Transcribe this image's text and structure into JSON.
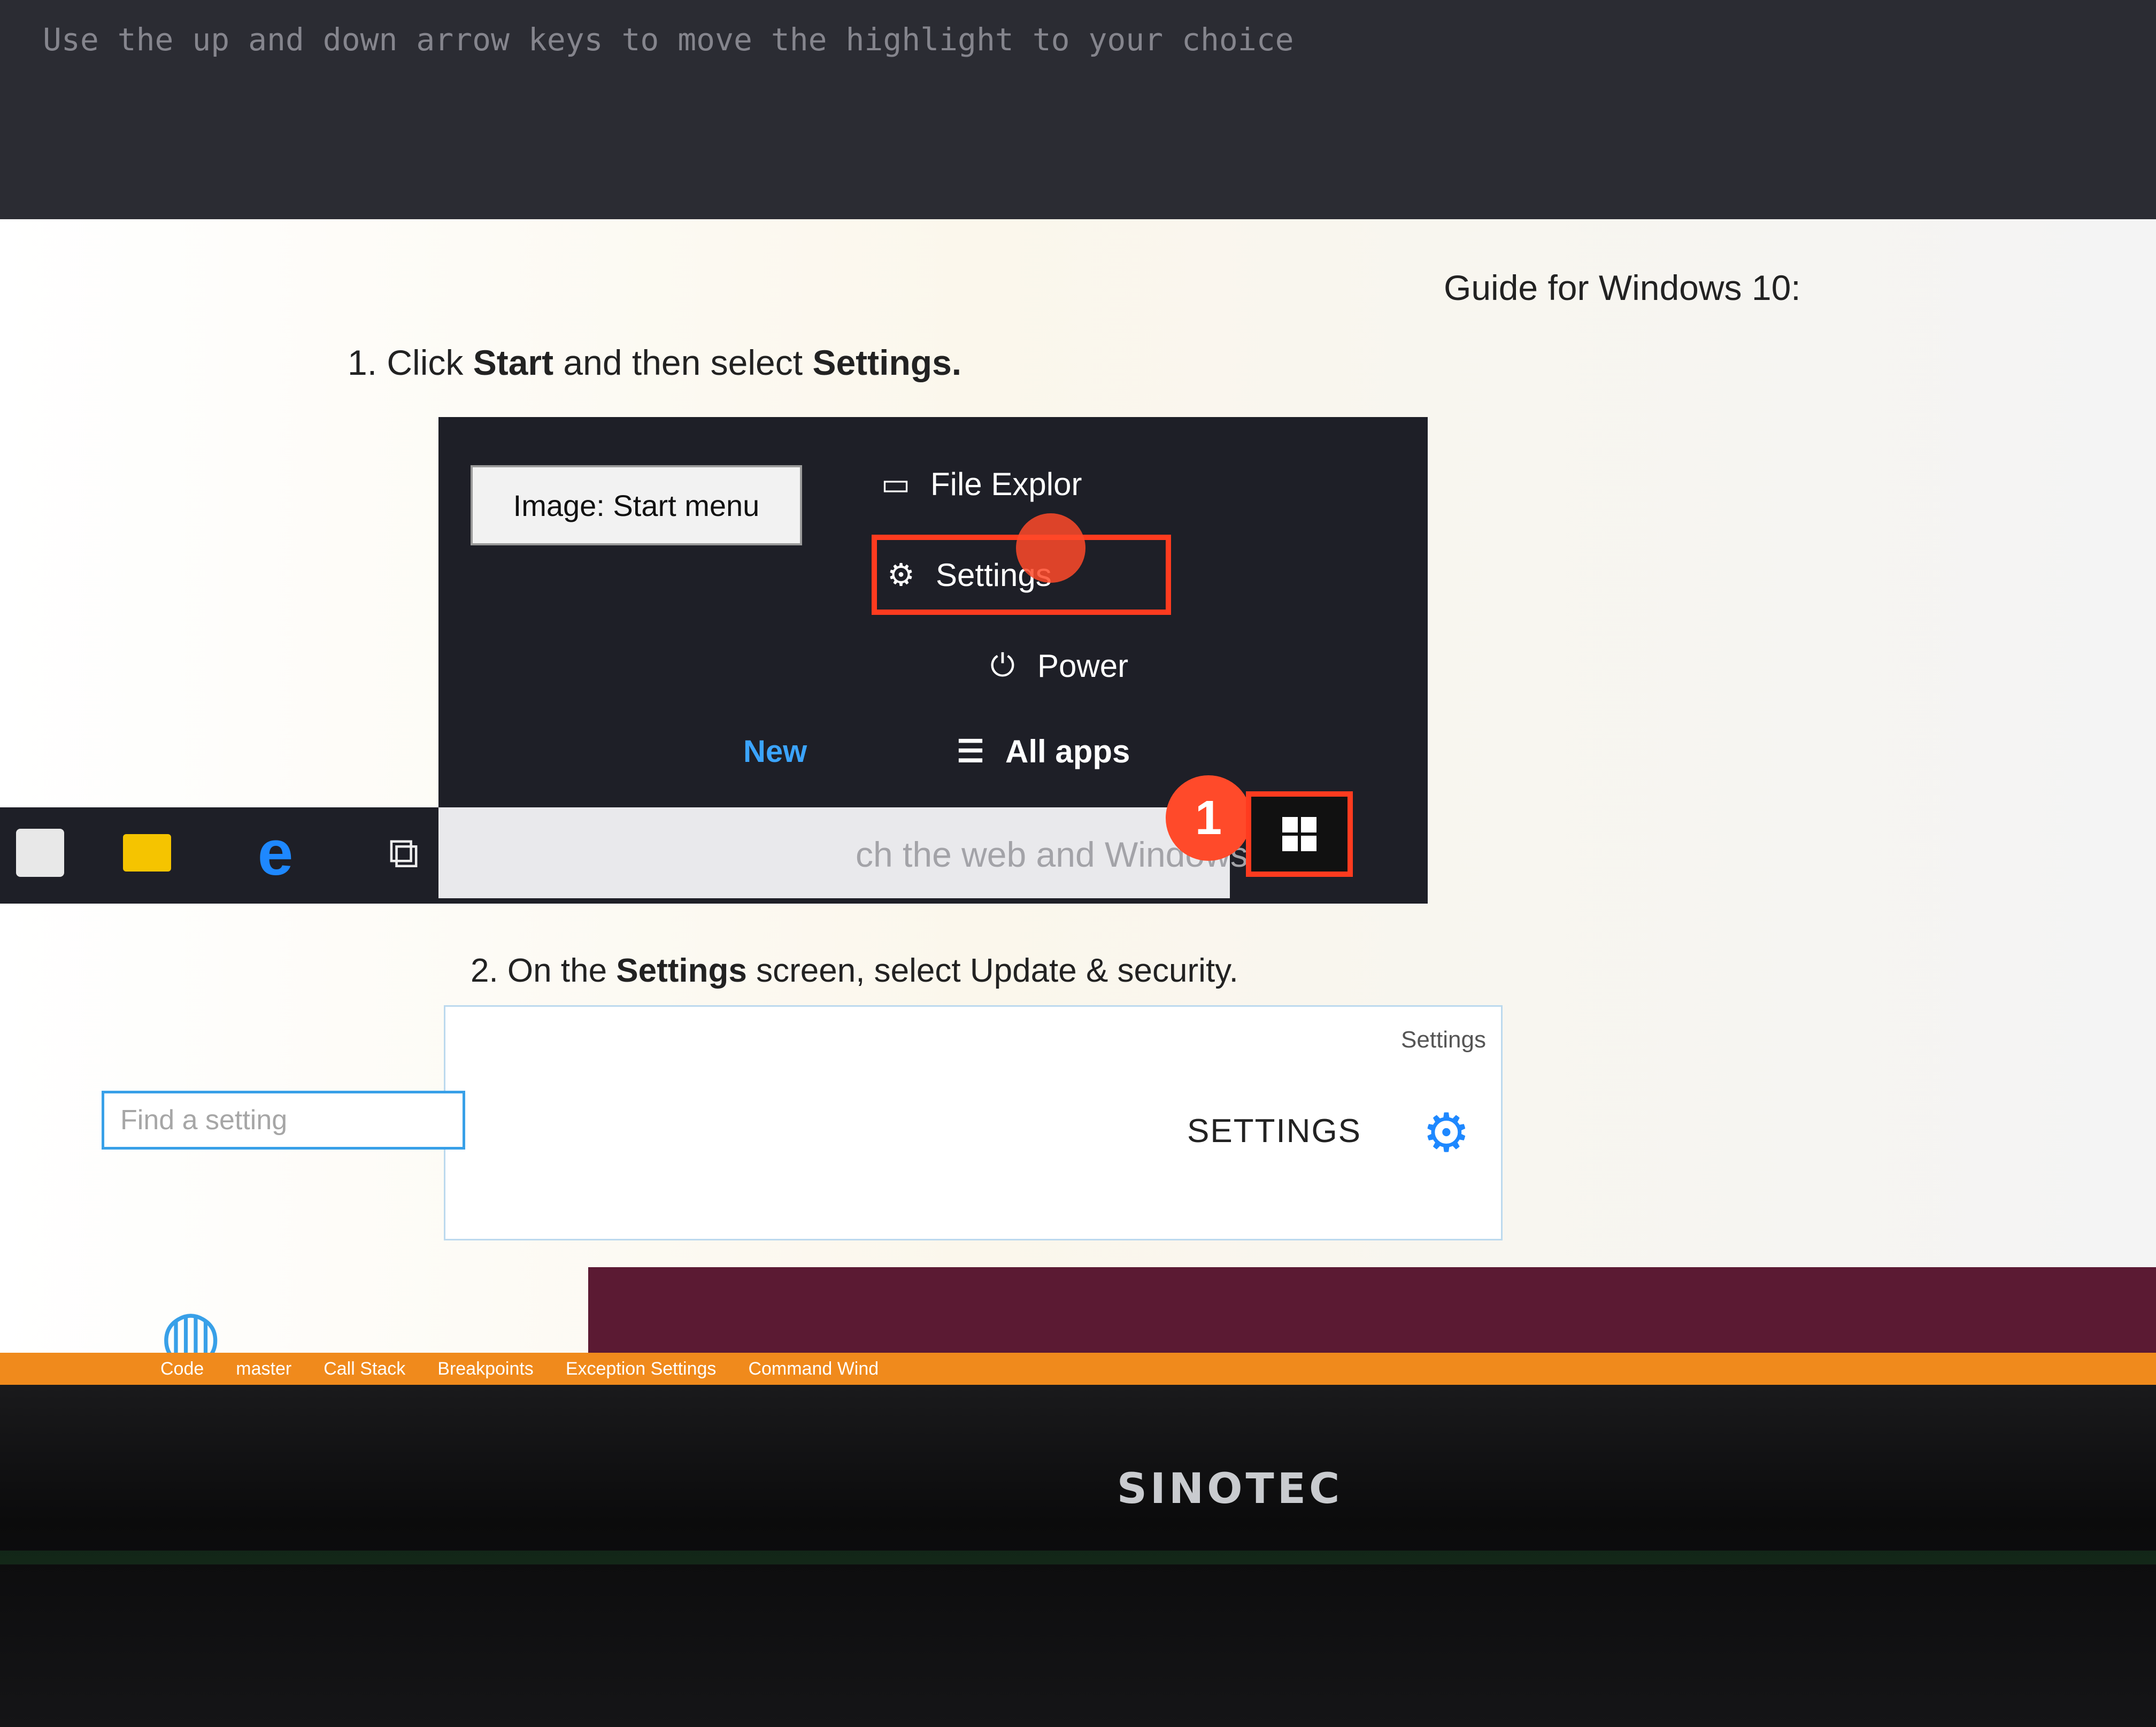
{
  "monitor": {
    "brand": "SINOTEC"
  },
  "terminal": {
    "text": "Use the up and down arrow keys to move the highlight to your choice"
  },
  "guide": {
    "title": "Guide for Windows 10:",
    "step1_prefix": "1.  Click ",
    "step1_start": "Start",
    "step1_middle": " and then select ",
    "step1_settings": "Settings.",
    "step2_prefix": "2.  On the ",
    "step2_settings": "Settings",
    "step2_suffix": " screen, select Update & security."
  },
  "start_menu": {
    "tooltip": "Image: Start menu",
    "items": [
      {
        "label": "File Explor",
        "icon": "folder-icon"
      },
      {
        "label": "Settings",
        "icon": "gear-icon"
      },
      {
        "label": "Power",
        "icon": "power-icon"
      },
      {
        "label": "All apps",
        "icon": "list-icon"
      }
    ],
    "new_label": "New",
    "badge": "1",
    "search_text": "ch the web and Windows"
  },
  "settings_window": {
    "small_title": "Settings",
    "big_title": "SETTINGS",
    "search_placeholder": "Find a setting"
  },
  "ide_status": [
    "Code",
    "master",
    "Call Stack",
    "Breakpoints",
    "Exception Settings",
    "Command Wind"
  ],
  "colors": {
    "highlight": "#ff3b1f",
    "badge": "#ff4a2a",
    "accent": "#1e88ff",
    "start_menu_bg": "#1e1f27"
  }
}
